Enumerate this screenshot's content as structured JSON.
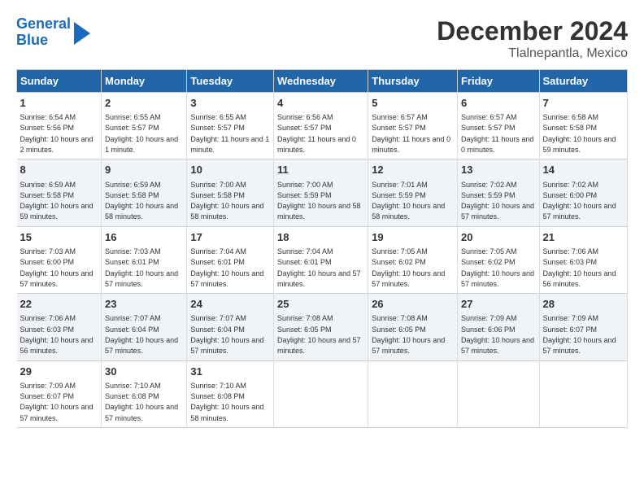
{
  "header": {
    "logo_line1": "General",
    "logo_line2": "Blue",
    "title": "December 2024",
    "subtitle": "Tlalnepantla, Mexico"
  },
  "days_of_week": [
    "Sunday",
    "Monday",
    "Tuesday",
    "Wednesday",
    "Thursday",
    "Friday",
    "Saturday"
  ],
  "weeks": [
    [
      {
        "day": "1",
        "sunrise": "6:54 AM",
        "sunset": "5:56 PM",
        "daylight": "10 hours and 2 minutes."
      },
      {
        "day": "2",
        "sunrise": "6:55 AM",
        "sunset": "5:57 PM",
        "daylight": "10 hours and 1 minute."
      },
      {
        "day": "3",
        "sunrise": "6:55 AM",
        "sunset": "5:57 PM",
        "daylight": "11 hours and 1 minute."
      },
      {
        "day": "4",
        "sunrise": "6:56 AM",
        "sunset": "5:57 PM",
        "daylight": "11 hours and 0 minutes."
      },
      {
        "day": "5",
        "sunrise": "6:57 AM",
        "sunset": "5:57 PM",
        "daylight": "11 hours and 0 minutes."
      },
      {
        "day": "6",
        "sunrise": "6:57 AM",
        "sunset": "5:57 PM",
        "daylight": "11 hours and 0 minutes."
      },
      {
        "day": "7",
        "sunrise": "6:58 AM",
        "sunset": "5:58 PM",
        "daylight": "10 hours and 59 minutes."
      }
    ],
    [
      {
        "day": "8",
        "sunrise": "6:59 AM",
        "sunset": "5:58 PM",
        "daylight": "10 hours and 59 minutes."
      },
      {
        "day": "9",
        "sunrise": "6:59 AM",
        "sunset": "5:58 PM",
        "daylight": "10 hours and 58 minutes."
      },
      {
        "day": "10",
        "sunrise": "7:00 AM",
        "sunset": "5:58 PM",
        "daylight": "10 hours and 58 minutes."
      },
      {
        "day": "11",
        "sunrise": "7:00 AM",
        "sunset": "5:59 PM",
        "daylight": "10 hours and 58 minutes."
      },
      {
        "day": "12",
        "sunrise": "7:01 AM",
        "sunset": "5:59 PM",
        "daylight": "10 hours and 58 minutes."
      },
      {
        "day": "13",
        "sunrise": "7:02 AM",
        "sunset": "5:59 PM",
        "daylight": "10 hours and 57 minutes."
      },
      {
        "day": "14",
        "sunrise": "7:02 AM",
        "sunset": "6:00 PM",
        "daylight": "10 hours and 57 minutes."
      }
    ],
    [
      {
        "day": "15",
        "sunrise": "7:03 AM",
        "sunset": "6:00 PM",
        "daylight": "10 hours and 57 minutes."
      },
      {
        "day": "16",
        "sunrise": "7:03 AM",
        "sunset": "6:01 PM",
        "daylight": "10 hours and 57 minutes."
      },
      {
        "day": "17",
        "sunrise": "7:04 AM",
        "sunset": "6:01 PM",
        "daylight": "10 hours and 57 minutes."
      },
      {
        "day": "18",
        "sunrise": "7:04 AM",
        "sunset": "6:01 PM",
        "daylight": "10 hours and 57 minutes."
      },
      {
        "day": "19",
        "sunrise": "7:05 AM",
        "sunset": "6:02 PM",
        "daylight": "10 hours and 57 minutes."
      },
      {
        "day": "20",
        "sunrise": "7:05 AM",
        "sunset": "6:02 PM",
        "daylight": "10 hours and 57 minutes."
      },
      {
        "day": "21",
        "sunrise": "7:06 AM",
        "sunset": "6:03 PM",
        "daylight": "10 hours and 56 minutes."
      }
    ],
    [
      {
        "day": "22",
        "sunrise": "7:06 AM",
        "sunset": "6:03 PM",
        "daylight": "10 hours and 56 minutes."
      },
      {
        "day": "23",
        "sunrise": "7:07 AM",
        "sunset": "6:04 PM",
        "daylight": "10 hours and 57 minutes."
      },
      {
        "day": "24",
        "sunrise": "7:07 AM",
        "sunset": "6:04 PM",
        "daylight": "10 hours and 57 minutes."
      },
      {
        "day": "25",
        "sunrise": "7:08 AM",
        "sunset": "6:05 PM",
        "daylight": "10 hours and 57 minutes."
      },
      {
        "day": "26",
        "sunrise": "7:08 AM",
        "sunset": "6:05 PM",
        "daylight": "10 hours and 57 minutes."
      },
      {
        "day": "27",
        "sunrise": "7:09 AM",
        "sunset": "6:06 PM",
        "daylight": "10 hours and 57 minutes."
      },
      {
        "day": "28",
        "sunrise": "7:09 AM",
        "sunset": "6:07 PM",
        "daylight": "10 hours and 57 minutes."
      }
    ],
    [
      {
        "day": "29",
        "sunrise": "7:09 AM",
        "sunset": "6:07 PM",
        "daylight": "10 hours and 57 minutes."
      },
      {
        "day": "30",
        "sunrise": "7:10 AM",
        "sunset": "6:08 PM",
        "daylight": "10 hours and 57 minutes."
      },
      {
        "day": "31",
        "sunrise": "7:10 AM",
        "sunset": "6:08 PM",
        "daylight": "10 hours and 58 minutes."
      },
      {
        "day": "",
        "sunrise": "",
        "sunset": "",
        "daylight": ""
      },
      {
        "day": "",
        "sunrise": "",
        "sunset": "",
        "daylight": ""
      },
      {
        "day": "",
        "sunrise": "",
        "sunset": "",
        "daylight": ""
      },
      {
        "day": "",
        "sunrise": "",
        "sunset": "",
        "daylight": ""
      }
    ]
  ]
}
